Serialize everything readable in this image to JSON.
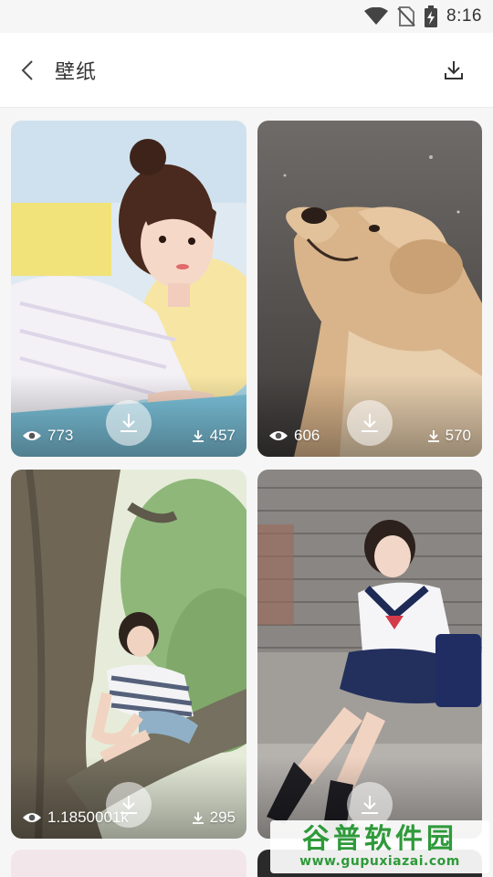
{
  "status_bar": {
    "time": "8:16",
    "icons": [
      "wifi-icon",
      "no-sim-icon",
      "battery-charging-icon"
    ]
  },
  "header": {
    "title": "壁纸",
    "back_icon": "chevron-left-icon",
    "download_icon": "download-icon"
  },
  "wallpapers": [
    {
      "subject": "girl lying on bed",
      "views": "773",
      "downloads": "457",
      "view_icon": "eye-icon",
      "download_icon": "download-icon"
    },
    {
      "subject": "golden retriever",
      "views": "606",
      "downloads": "570",
      "view_icon": "eye-icon",
      "download_icon": "download-icon"
    },
    {
      "subject": "girl sitting on tree",
      "views": "1.1850001k",
      "downloads": "295",
      "view_icon": "eye-icon",
      "download_icon": "download-icon"
    },
    {
      "subject": "girl in school uniform by brick wall",
      "views": "",
      "downloads": "",
      "view_icon": "eye-icon",
      "download_icon": "download-icon"
    }
  ],
  "watermark": {
    "title": "谷普软件园",
    "url": "www.gupuxiazai.com"
  }
}
